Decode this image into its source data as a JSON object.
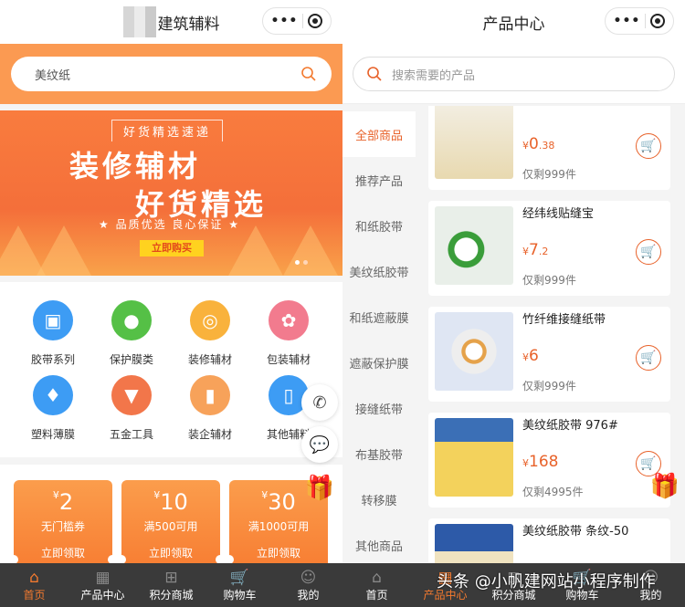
{
  "left": {
    "title": "建筑辅料",
    "search_value": "美纹纸",
    "banner": {
      "tag": "好货精选速递",
      "line1": "装修辅材",
      "line2": "好货精选",
      "slogan": "★ 品质优选  良心保证 ★",
      "button": "立即购买"
    },
    "categories": [
      {
        "label": "胶带系列",
        "icon": "box-icon",
        "color": "#3d9cf4"
      },
      {
        "label": "保护膜类",
        "icon": "apple-icon",
        "color": "#55c046"
      },
      {
        "label": "装修辅材",
        "icon": "donut-icon",
        "color": "#f9b23c"
      },
      {
        "label": "包装辅材",
        "icon": "flower-icon",
        "color": "#f27b8e"
      },
      {
        "label": "塑料薄膜",
        "icon": "dress-icon",
        "color": "#3d9cf4"
      },
      {
        "label": "五金工具",
        "icon": "cup-icon",
        "color": "#f2764a"
      },
      {
        "label": "装企辅材",
        "icon": "cosmetics-icon",
        "color": "#f7a25a"
      },
      {
        "label": "其他辅料",
        "icon": "phone-icon",
        "color": "#3d9cf4"
      }
    ],
    "coupons": [
      {
        "amount": "2",
        "desc": "无门槛券",
        "action": "立即领取"
      },
      {
        "amount": "10",
        "desc": "满500可用",
        "action": "立即领取"
      },
      {
        "amount": "30",
        "desc": "满1000可用",
        "action": "立即领取"
      }
    ]
  },
  "right": {
    "title": "产品中心",
    "search_placeholder": "搜索需要的产品",
    "sidebar": [
      "全部商品",
      "推荐产品",
      "和纸胶带",
      "美纹纸胶带",
      "和纸遮蔽膜",
      "遮蔽保护膜",
      "接缝纸带",
      "布基胶带",
      "转移膜",
      "其他商品"
    ],
    "products": [
      {
        "name": "",
        "price_int": "0",
        "price_dec": ".38",
        "stock": "仅剩999件"
      },
      {
        "name": "经纬线贴缝宝",
        "price_int": "7",
        "price_dec": ".2",
        "stock": "仅剩999件"
      },
      {
        "name": "竹纤维接缝纸带",
        "price_int": "6",
        "price_dec": "",
        "stock": "仅剩999件"
      },
      {
        "name": "美纹纸胶带 976#",
        "price_int": "168",
        "price_dec": "",
        "stock": "仅剩4995件"
      },
      {
        "name": "美纹纸胶带 条纹-50",
        "price_int": "",
        "price_dec": "",
        "stock": ""
      }
    ]
  },
  "currency": "¥",
  "tabbar": [
    "首页",
    "产品中心",
    "积分商城",
    "购物车",
    "我的"
  ],
  "watermark": "头条 @小帆建网站小程序制作",
  "accent": "#f37a2f"
}
